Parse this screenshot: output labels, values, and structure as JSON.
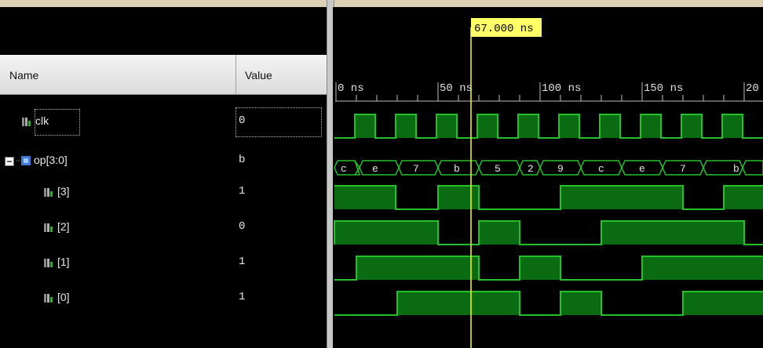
{
  "cursor": {
    "label": "67.000 ns"
  },
  "columns": {
    "name": "Name",
    "value": "Value"
  },
  "timescale": {
    "ticks": [
      "0 ns",
      "50 ns",
      "100 ns",
      "150 ns",
      "20"
    ]
  },
  "signals": [
    {
      "name": "clk",
      "value": "0",
      "kind": "bit"
    },
    {
      "name": "op[3:0]",
      "value": "b",
      "kind": "bus",
      "bus_values": [
        "c",
        "e",
        "7",
        "b",
        "5",
        "2",
        "9",
        "c",
        "e",
        "7",
        "b"
      ]
    },
    {
      "name": "[3]",
      "value": "1",
      "kind": "bit"
    },
    {
      "name": "[2]",
      "value": "0",
      "kind": "bit"
    },
    {
      "name": "[1]",
      "value": "1",
      "kind": "bit"
    },
    {
      "name": "[0]",
      "value": "1",
      "kind": "bit"
    }
  ],
  "colors": {
    "wave": "#22c12a",
    "wave_fill": "#0b6b12",
    "cursor": "#ffff00",
    "cursor_label_bg": "#ffff66"
  }
}
